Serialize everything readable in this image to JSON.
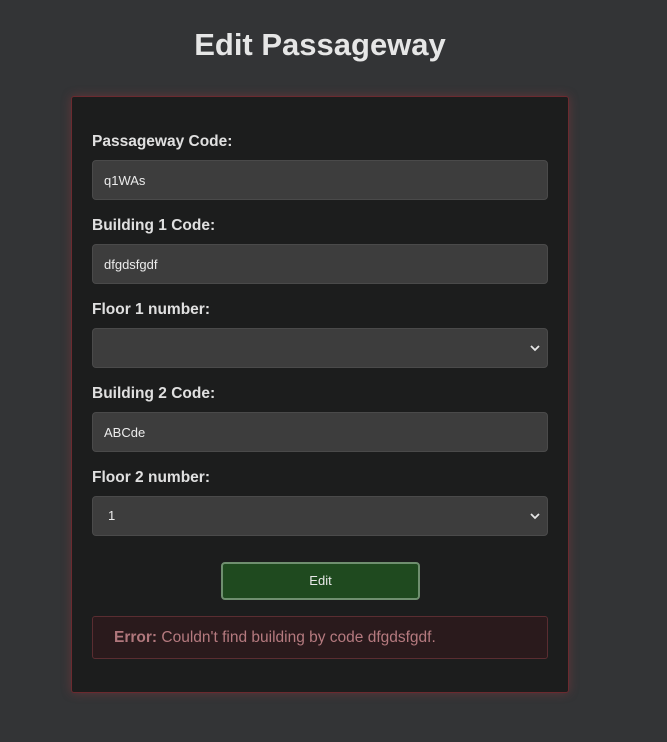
{
  "page": {
    "title": "Edit Passageway"
  },
  "form": {
    "passageway_code": {
      "label": "Passageway Code:",
      "value": "q1WAs"
    },
    "building1_code": {
      "label": "Building 1 Code:",
      "value": "dfgdsfgdf"
    },
    "floor1_number": {
      "label": "Floor 1 number:",
      "value": ""
    },
    "building2_code": {
      "label": "Building 2 Code:",
      "value": "ABCde"
    },
    "floor2_number": {
      "label": "Floor 2 number:",
      "value": "1"
    },
    "submit_label": "Edit"
  },
  "error": {
    "prefix": "Error:",
    "message": "Couldn't find building by code dfgdsfgdf."
  },
  "icons": {
    "select_arrow": "chevron-down-icon"
  },
  "colors": {
    "background": "#333436",
    "card": "#1c1d1d",
    "card_border": "#6b2a2f",
    "input_bg": "#3d3d3d",
    "button_bg": "#1f4a1f",
    "error_bg": "#2a1a1c",
    "error_text": "#b57a7f"
  }
}
